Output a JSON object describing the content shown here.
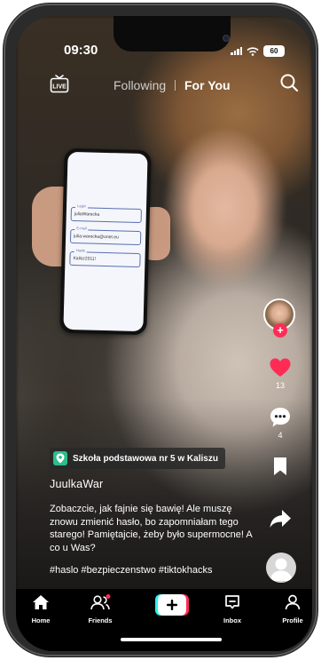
{
  "status_bar": {
    "time": "09:30",
    "battery": "60"
  },
  "top_nav": {
    "live_label": "LIVE",
    "tab_following": "Following",
    "tab_for_you": "For You"
  },
  "held_phone_form": [
    {
      "label": "Login",
      "value": "juliaWarecka"
    },
    {
      "label": "E-mail",
      "value": "julia.warecka@onet.eu"
    },
    {
      "label": "Hasło",
      "value": "Kalisz2011!"
    }
  ],
  "right_rail": {
    "likes": "13",
    "comments": "4"
  },
  "video": {
    "location": "Szkoła podstawowa nr 5 w Kaliszu",
    "username": "JuulkaWar",
    "caption": "Zobaczcie, jak fajnie się bawię! Ale muszę znowu zmienić hasło, bo zapomniałam tego starego! Pamiętajcie, żeby było supermocne! A co u Was?",
    "hashtags": "#haslo #bezpieczenstwo #tiktokhacks"
  },
  "bottom_nav": {
    "home": "Home",
    "friends": "Friends",
    "inbox": "Inbox",
    "profile": "Profile"
  },
  "colors": {
    "like": "#fe2c55",
    "create_left": "#25f4ee",
    "create_right": "#fe2c55",
    "location_pin": "#2bbd8e"
  }
}
